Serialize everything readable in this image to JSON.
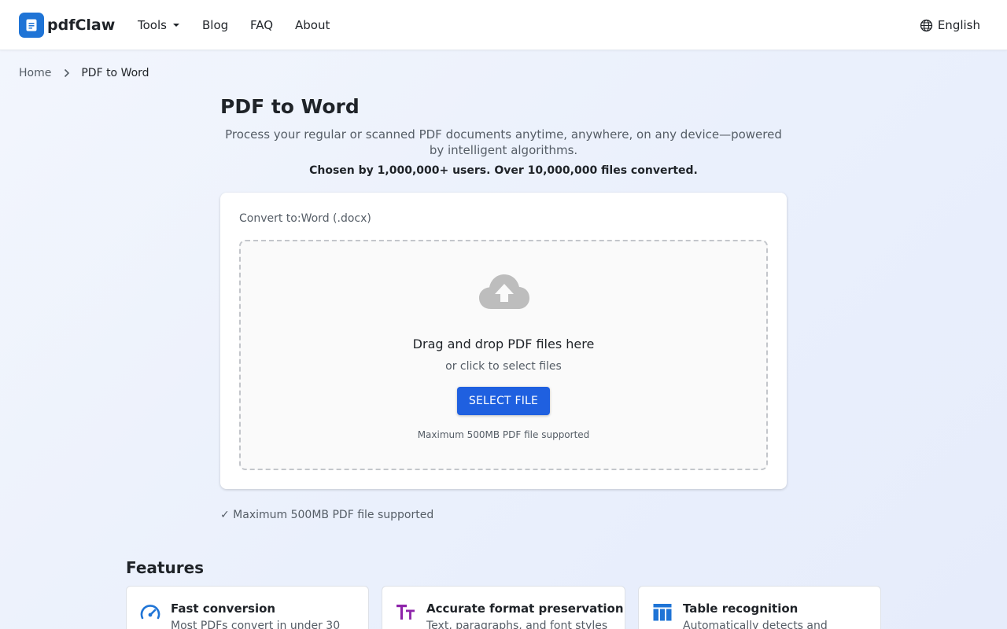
{
  "header": {
    "logo_text": "pdfClaw",
    "nav": {
      "tools": "Tools",
      "blog": "Blog",
      "faq": "FAQ",
      "about": "About"
    },
    "language": "English"
  },
  "breadcrumb": {
    "home": "Home",
    "current": "PDF to Word"
  },
  "page": {
    "title": "PDF to Word",
    "subtitle": "Process your regular or scanned PDF documents anytime, anywhere, on any device—powered by intelligent algorithms.",
    "stats": "Chosen by 1,000,000+ users. Over 10,000,000 files converted."
  },
  "converter": {
    "convert_to_label": "Convert to:",
    "convert_to_value": "Word (.docx)",
    "drop_title": "Drag and drop PDF files here",
    "drop_sub": "or click to select files",
    "select_button": "SELECT FILE",
    "drop_note": "Maximum 500MB PDF file supported"
  },
  "support_line": "✓ Maximum 500MB PDF file supported",
  "features": {
    "title": "Features",
    "items": [
      {
        "title": "Fast conversion",
        "desc": "Most PDFs convert in under 30",
        "icon": "speedometer-icon",
        "color": "#1f74d6"
      },
      {
        "title": "Accurate format preservation",
        "desc": "Text, paragraphs, and font styles",
        "icon": "text-size-icon",
        "color": "#8e24aa"
      },
      {
        "title": "Table recognition",
        "desc": "Automatically detects and",
        "icon": "table-icon",
        "color": "#1f74d6"
      }
    ]
  },
  "colors": {
    "brand": "#1f74d6",
    "primary_button": "#1f60e0"
  }
}
